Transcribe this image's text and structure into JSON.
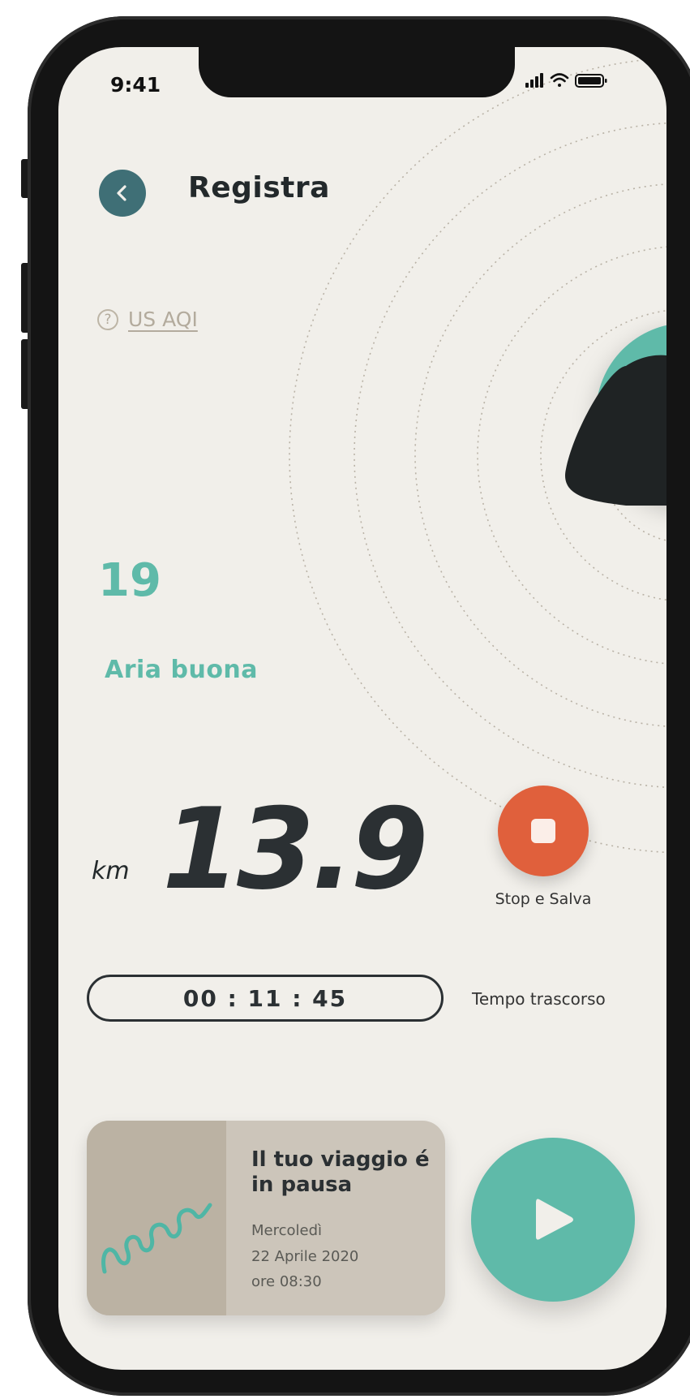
{
  "status_bar": {
    "time": "9:41"
  },
  "header": {
    "title": "Registra"
  },
  "aqi": {
    "link_label": "US AQI",
    "help_glyph": "?",
    "value": "19",
    "quality_label": "Aria buona"
  },
  "distance": {
    "unit": "km",
    "value": "13.9"
  },
  "stop": {
    "label": "Stop e Salva"
  },
  "timer": {
    "value": "00 : 11 : 45",
    "label": "Tempo trascorso"
  },
  "trip": {
    "title": "Il tuo viaggio é in pausa",
    "day": "Mercoledì",
    "date": "22 Aprile 2020",
    "time": "ore 08:30"
  },
  "icons": [
    "back-arrow-icon",
    "help-icon",
    "stop-icon",
    "play-icon",
    "signal-icon",
    "wifi-icon",
    "battery-icon",
    "route-map-icon"
  ],
  "colors": {
    "accent_teal": "#5fbaa9",
    "back_button": "#3f6f76",
    "stop_red": "#e0603c",
    "background": "#f1efea",
    "card": "#ccc5ba"
  }
}
